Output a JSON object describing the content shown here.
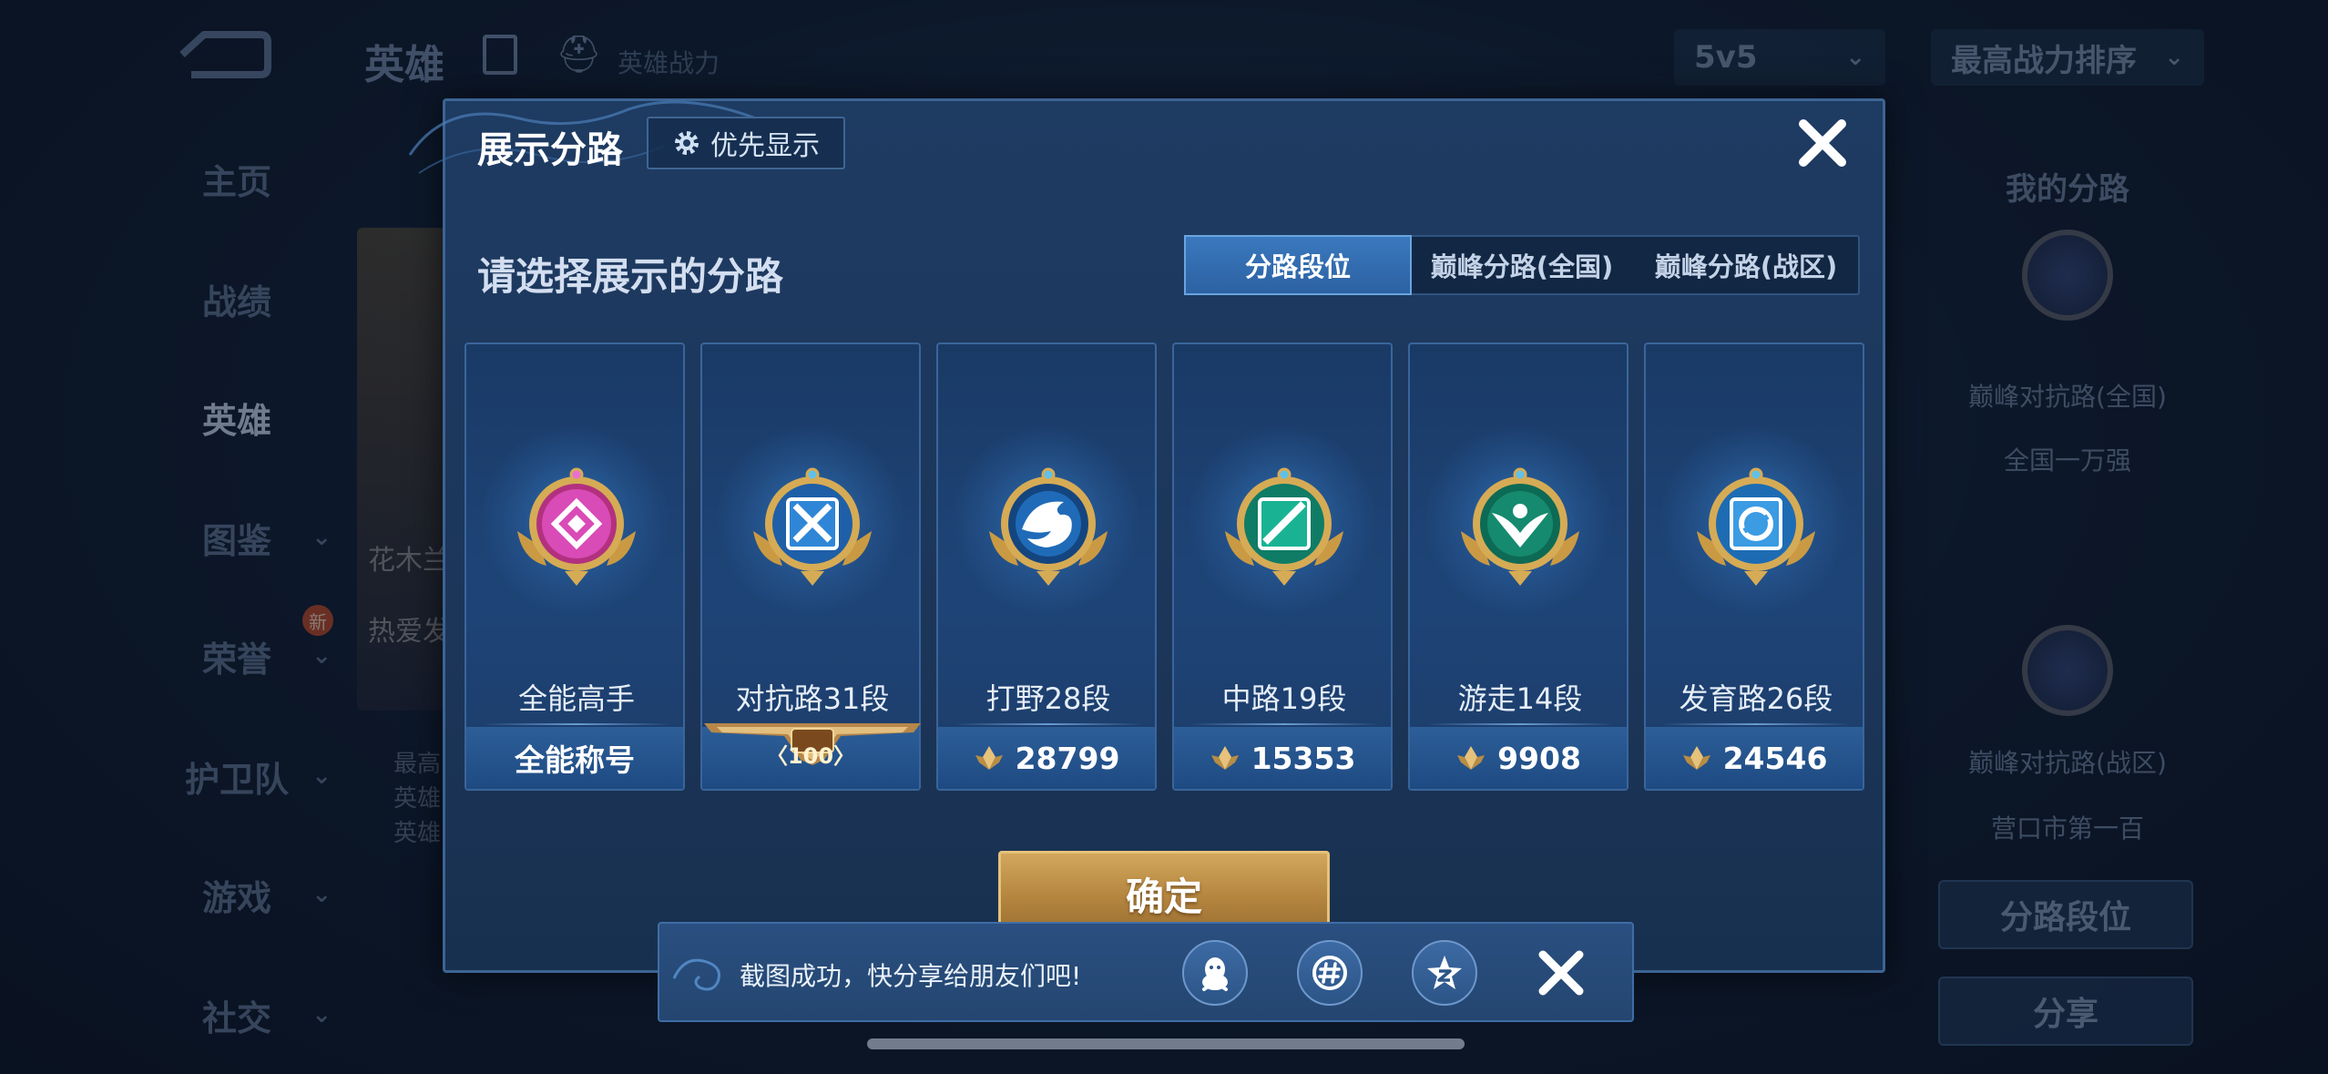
{
  "background": {
    "title": "英雄",
    "subtitle": "英雄战力",
    "mode_dropdown": "5v5",
    "sort_dropdown": "最高战力排序",
    "nav": [
      {
        "label": "主页",
        "has_chevron": false,
        "active": false
      },
      {
        "label": "战绩",
        "has_chevron": false,
        "active": false
      },
      {
        "label": "英雄",
        "has_chevron": false,
        "active": true
      },
      {
        "label": "图鉴",
        "has_chevron": true,
        "active": false
      },
      {
        "label": "荣誉",
        "has_chevron": true,
        "active": false
      },
      {
        "label": "护卫队",
        "has_chevron": true,
        "active": false
      },
      {
        "label": "游戏",
        "has_chevron": true,
        "active": false
      },
      {
        "label": "社交",
        "has_chevron": true,
        "active": false
      }
    ],
    "new_badge": "新",
    "hero_card_line1": "花木兰",
    "hero_card_line2": "热爱发",
    "left_lines": [
      "最高",
      "英雄",
      "英雄"
    ],
    "right_panel": {
      "title": "我的分路",
      "rank1": "巅峰对抗路(全国)",
      "rank1_detail": "全国一万强",
      "rank2": "巅峰对抗路(战区)",
      "rank2_detail": "营口市第一百",
      "button1": "分路段位",
      "button2": "分享"
    }
  },
  "modal": {
    "title": "展示分路",
    "priority_button": "优先显示",
    "prompt": "请选择展示的分路",
    "tabs": [
      {
        "label": "分路段位",
        "active": true
      },
      {
        "label": "巅峰分路(全国)",
        "active": false
      },
      {
        "label": "巅峰分路(战区)",
        "active": false
      }
    ],
    "cards": [
      {
        "name": "全能高手",
        "footer": "全能称号",
        "footer_type": "title",
        "badge": "all-rounder-badge-icon",
        "color": "#c0359f"
      },
      {
        "name": "对抗路31段",
        "footer": "100",
        "footer_type": "plate",
        "badge": "clash-lane-badge-icon",
        "color": "#2d7fd0"
      },
      {
        "name": "打野28段",
        "footer": "28799",
        "footer_type": "points",
        "badge": "jungle-badge-icon",
        "color": "#1f6bb8"
      },
      {
        "name": "中路19段",
        "footer": "15353",
        "footer_type": "points",
        "badge": "mid-lane-badge-icon",
        "color": "#19a888"
      },
      {
        "name": "游走14段",
        "footer": "9908",
        "footer_type": "points",
        "badge": "roam-badge-icon",
        "color": "#178a6e"
      },
      {
        "name": "发育路26段",
        "footer": "24546",
        "footer_type": "points",
        "badge": "farm-lane-badge-icon",
        "color": "#2f8fd8"
      }
    ],
    "confirm_button": "确定"
  },
  "toast": {
    "message": "截图成功，快分享给朋友们吧!",
    "share_targets": [
      "qq-icon",
      "wechat-moments-icon",
      "qzone-icon"
    ]
  },
  "colors": {
    "accent": "#3a78bd",
    "gold": "#d2a75d",
    "modal_bg": "#1e3b62"
  }
}
